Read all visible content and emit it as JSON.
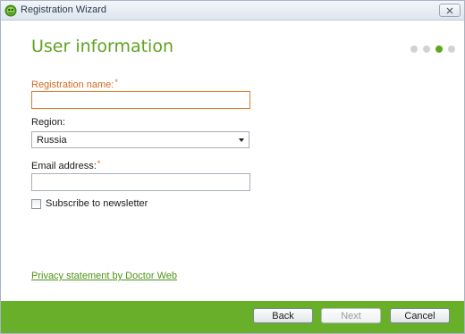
{
  "window": {
    "title": "Registration Wizard",
    "app_icon": "dr-web-spider-icon",
    "close_icon": "close-icon"
  },
  "page": {
    "title": "User information",
    "steps_total": 4,
    "current_step": 3
  },
  "form": {
    "registration_name": {
      "label": "Registration name:",
      "required_mark": "*",
      "value": ""
    },
    "region": {
      "label": "Region:",
      "selected": "Russia"
    },
    "email": {
      "label": "Email address:",
      "required_mark": "*",
      "value": ""
    },
    "subscribe": {
      "label": "Subscribe to newsletter",
      "checked": false
    }
  },
  "privacy_link": "Privacy statement by Doctor Web",
  "footer": {
    "back_label": "Back",
    "next_label": "Next",
    "cancel_label": "Cancel"
  },
  "colors": {
    "accent_green": "#5ea31f",
    "footer_green": "#69b02a",
    "required_orange": "#e36a1c"
  }
}
